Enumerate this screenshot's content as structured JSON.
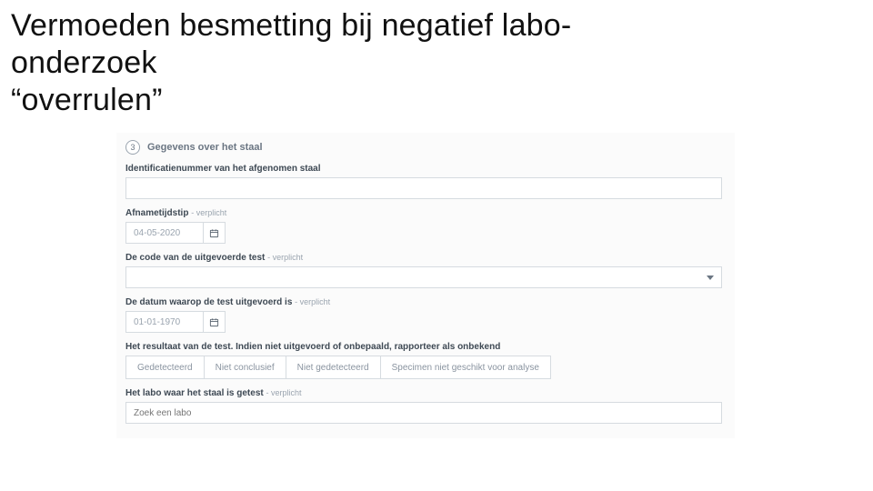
{
  "slide": {
    "title_line1": "Vermoeden besmetting bij negatief labo-",
    "title_line2": "onderzoek",
    "title_line3": "“overrulen”"
  },
  "form": {
    "step_number": "3",
    "section_title": "Gegevens over het staal",
    "id_label": "Identificatienummer van het afgenomen staal",
    "time_label": "Afnametijdstip",
    "time_req": "- verplicht",
    "time_value": "04-05-2020",
    "testcode_label": "De code van de uitgevoerde test",
    "testcode_req": "- verplicht",
    "testdate_label": "De datum waarop de test uitgevoerd is",
    "testdate_req": "- verplicht",
    "testdate_value": "01-01-1970",
    "result_label": "Het resultaat van de test. Indien niet uitgevoerd of onbepaald, rapporteer als onbekend",
    "result_options": {
      "detected": "Gedetecteerd",
      "not_conclusive": "Niet conclusief",
      "not_detected": "Niet gedetecteerd",
      "unsuitable": "Specimen niet geschikt voor analyse"
    },
    "labo_label": "Het labo waar het staal is getest",
    "labo_req": "- verplicht",
    "labo_placeholder": "Zoek een labo"
  }
}
